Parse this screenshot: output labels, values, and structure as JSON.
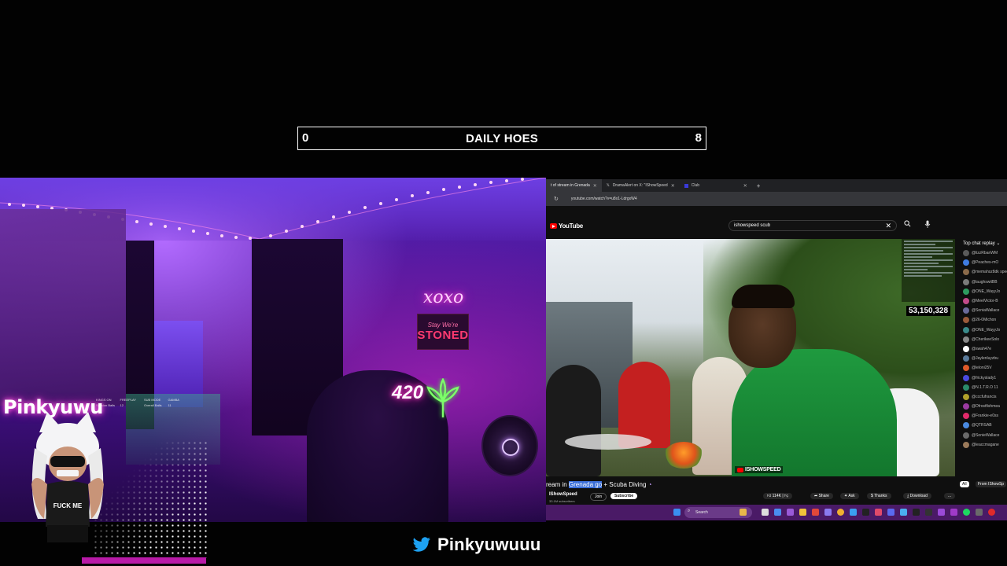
{
  "scoreboard": {
    "left_value": "0",
    "title": "DAILY HOES",
    "right_value": "8"
  },
  "webcam": {
    "neon_xoxo": "xoxo",
    "sign_line1": "Stay We're",
    "sign_line2": "STONED",
    "neon_420": "420",
    "room_sign": "Pinkyuwu",
    "stats_labels": [
      "KINGS ON",
      "FREEPLAY",
      "SUB MODE",
      "GAMBA"
    ],
    "stats_values": [
      "Session Balls",
      "12",
      "Overall Balls",
      "11"
    ],
    "avatar_shirt": "FUCK ME"
  },
  "browser": {
    "tabs": [
      {
        "label": "t of stream in Grenada",
        "active": true
      },
      {
        "label": "DramaAlert on X: \"IShowSpeed",
        "active": false
      },
      {
        "label": "Club",
        "active": false
      }
    ],
    "new_tab": "+",
    "url": "youtube.com/watch?v=u8x1-LdrgxW4"
  },
  "youtube": {
    "logo": "YouTube",
    "search_value": "ishowspeed scub",
    "clear": "✕",
    "search_icon": "search-icon",
    "mic_icon": "mic-icon",
    "viewer_count": "53,150,328",
    "watermark": "ISHOWSPEED",
    "video_title_pre": "ream in ",
    "video_title_hl": "Grenada go",
    "video_title_post": " + Scuba Diving",
    "channel": "IShowSpeed",
    "subscribers": "33.1M subscribers",
    "join": "Join",
    "subscribe": "Subscribe",
    "likes": "114K",
    "share": "Share",
    "ask": "Ask",
    "thanks": "Thanks",
    "download": "Download",
    "more": "...",
    "chat_header": "Top chat replay",
    "chat_users": [
      "@lizzRbanWM",
      "@Peaches-mO",
      "@memahsz8dk speed",
      "@laughswitBB",
      "@ONE_WayyJo",
      "@MeelVictor-B",
      "@SoniaWallace",
      "@26-0Michon",
      "@ONE_WayyJo",
      "@CherikeeSolo",
      "@swah47e",
      "@Jaylenluyzbu",
      "@leloni25V",
      "@frickyslady1",
      "@N.1.T.R.O 11",
      "@cccfufrancis",
      "@Dfrostfishmea",
      "@Frankie-e0ss",
      "@QTRSAB",
      "@SonieWallace",
      "@leaccmagane"
    ],
    "chat_avatar_colors": [
      "#5a5a5a",
      "#3f7be0",
      "#8a6a4a",
      "#7a7a7a",
      "#2d9a5f",
      "#c24a8a",
      "#6a6a9a",
      "#9a5a3a",
      "#3a8a8a",
      "#888",
      "#ffffff",
      "#5a7a9a",
      "#e05a2a",
      "#4a4ae0",
      "#2a8a6a",
      "#b0a02a",
      "#9a3aa0",
      "#e02a6a",
      "#4a8ae0",
      "#6a6a6a",
      "#9a7a5a"
    ],
    "filter_all": "All",
    "filter_from": "From IShowSp"
  },
  "taskbar": {
    "search_placeholder": "Search"
  },
  "footer": {
    "handle": "Pinkyuwuuu"
  }
}
